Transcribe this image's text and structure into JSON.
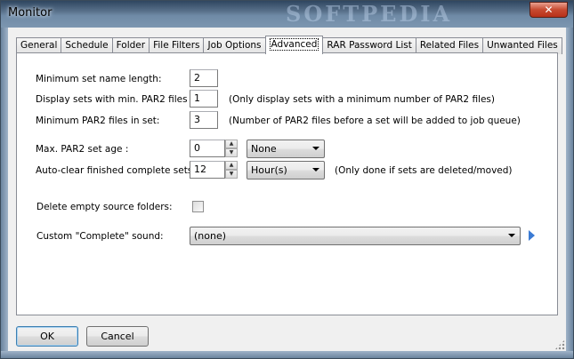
{
  "window": {
    "title": "Monitor",
    "watermark": "SOFTPEDIA",
    "close_label": "✕"
  },
  "tabs": [
    {
      "label": "General"
    },
    {
      "label": "Schedule"
    },
    {
      "label": "Folder"
    },
    {
      "label": "File Filters"
    },
    {
      "label": "Job Options"
    },
    {
      "label": "Advanced",
      "active": true
    },
    {
      "label": "RAR Password List"
    },
    {
      "label": "Related Files"
    },
    {
      "label": "Unwanted Files"
    }
  ],
  "advanced": {
    "min_set_name_length": {
      "label": "Minimum set name length:",
      "value": "2"
    },
    "display_sets_min_par2": {
      "label": "Display sets with min. PAR2 files",
      "value": "1",
      "note": "(Only display sets with a minimum number of PAR2 files)"
    },
    "min_par2_files_in_set": {
      "label": "Minimum PAR2 files in set:",
      "value": "3",
      "note": "(Number of PAR2 files before a set will be added to job queue)"
    },
    "max_par2_set_age": {
      "label": "Max. PAR2 set age :",
      "value": "0",
      "unit": "None"
    },
    "auto_clear": {
      "label": "Auto-clear finished complete sets:",
      "value": "12",
      "unit": "Hour(s)",
      "note": "(Only done if sets are deleted/moved)"
    },
    "delete_empty_source": {
      "label": "Delete empty source folders:",
      "checked": false
    },
    "complete_sound": {
      "label": "Custom \"Complete\" sound:",
      "value": "(none)"
    }
  },
  "buttons": {
    "ok": "OK",
    "cancel": "Cancel"
  },
  "colors": {
    "play_icon": "#3b7bd4",
    "title_bar": "#4a6480"
  }
}
